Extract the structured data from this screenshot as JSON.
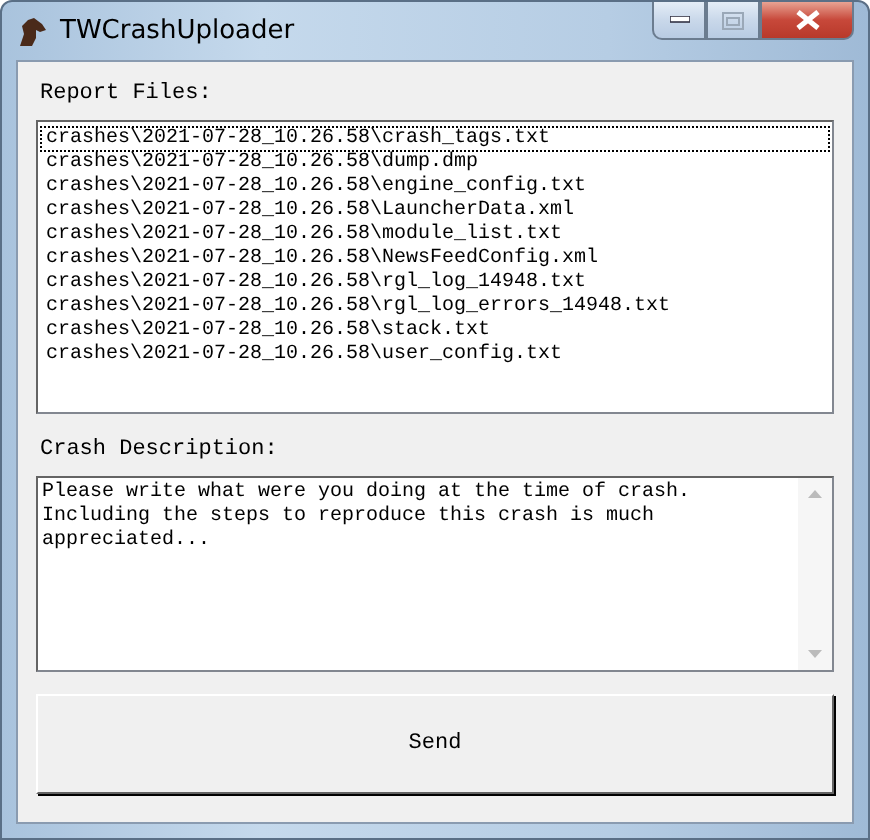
{
  "window": {
    "title": "TWCrashUploader"
  },
  "report_files": {
    "label": "Report Files:",
    "items": [
      {
        "text": "crashes\\2021-07-28_10.26.58\\crash_tags.txt",
        "selected": true
      },
      {
        "text": "crashes\\2021-07-28_10.26.58\\dump.dmp",
        "selected": false
      },
      {
        "text": "crashes\\2021-07-28_10.26.58\\engine_config.txt",
        "selected": false
      },
      {
        "text": "crashes\\2021-07-28_10.26.58\\LauncherData.xml",
        "selected": false
      },
      {
        "text": "crashes\\2021-07-28_10.26.58\\module_list.txt",
        "selected": false
      },
      {
        "text": "crashes\\2021-07-28_10.26.58\\NewsFeedConfig.xml",
        "selected": false
      },
      {
        "text": "crashes\\2021-07-28_10.26.58\\rgl_log_14948.txt",
        "selected": false
      },
      {
        "text": "crashes\\2021-07-28_10.26.58\\rgl_log_errors_14948.txt",
        "selected": false
      },
      {
        "text": "crashes\\2021-07-28_10.26.58\\stack.txt",
        "selected": false
      },
      {
        "text": "crashes\\2021-07-28_10.26.58\\user_config.txt",
        "selected": false
      }
    ]
  },
  "crash_description": {
    "label": "Crash Description:",
    "value": "Please write what were you doing at the time of crash.\nIncluding the steps to reproduce this crash is much appreciated..."
  },
  "buttons": [
    "Send"
  ]
}
